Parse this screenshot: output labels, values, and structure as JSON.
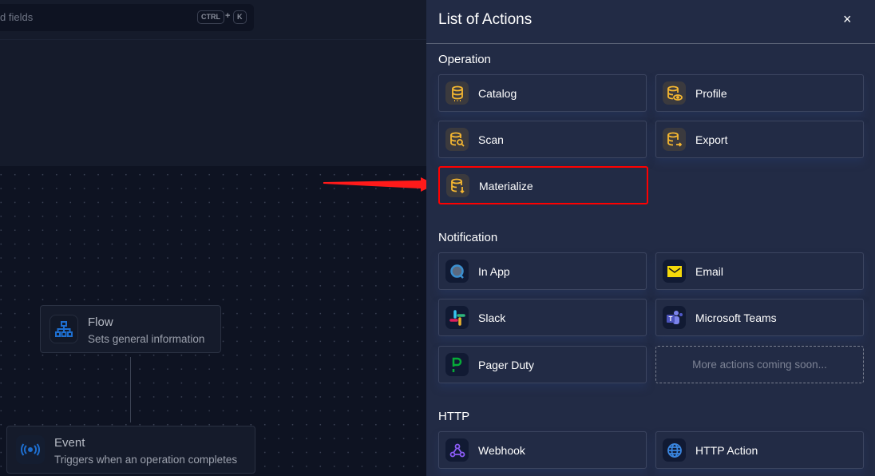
{
  "search": {
    "placeholder_fragment": "d fields",
    "shortcut_key1": "CTRL",
    "shortcut_plus": "+",
    "shortcut_key2": "K"
  },
  "canvas": {
    "flow_node": {
      "title": "Flow",
      "subtitle": "Sets general information",
      "icon": "sitemap-icon"
    },
    "event_node": {
      "title": "Event",
      "subtitle": "Triggers when an operation completes",
      "icon": "broadcast-icon"
    }
  },
  "panel": {
    "title": "List of Actions",
    "close_icon": "×",
    "sections": [
      {
        "title": "Operation",
        "items": [
          {
            "label": "Catalog",
            "icon": "database-catalog-icon"
          },
          {
            "label": "Profile",
            "icon": "database-eye-icon"
          },
          {
            "label": "Scan",
            "icon": "database-search-icon"
          },
          {
            "label": "Export",
            "icon": "database-export-icon"
          },
          {
            "label": "Materialize",
            "icon": "database-download-icon",
            "highlighted": true
          }
        ]
      },
      {
        "title": "Notification",
        "items": [
          {
            "label": "In App",
            "icon": "in-app-icon"
          },
          {
            "label": "Email",
            "icon": "email-icon"
          },
          {
            "label": "Slack",
            "icon": "slack-icon"
          },
          {
            "label": "Microsoft Teams",
            "icon": "teams-icon"
          },
          {
            "label": "Pager Duty",
            "icon": "pagerduty-icon"
          }
        ],
        "placeholder": "More actions coming soon..."
      },
      {
        "title": "HTTP",
        "items": [
          {
            "label": "Webhook",
            "icon": "webhook-icon"
          },
          {
            "label": "HTTP Action",
            "icon": "globe-icon"
          }
        ]
      }
    ]
  },
  "colors": {
    "panel_bg": "#222b45",
    "operation_icon": "#f5b731",
    "highlight": "#ff0000",
    "canvas_bg": "#0e1322"
  }
}
